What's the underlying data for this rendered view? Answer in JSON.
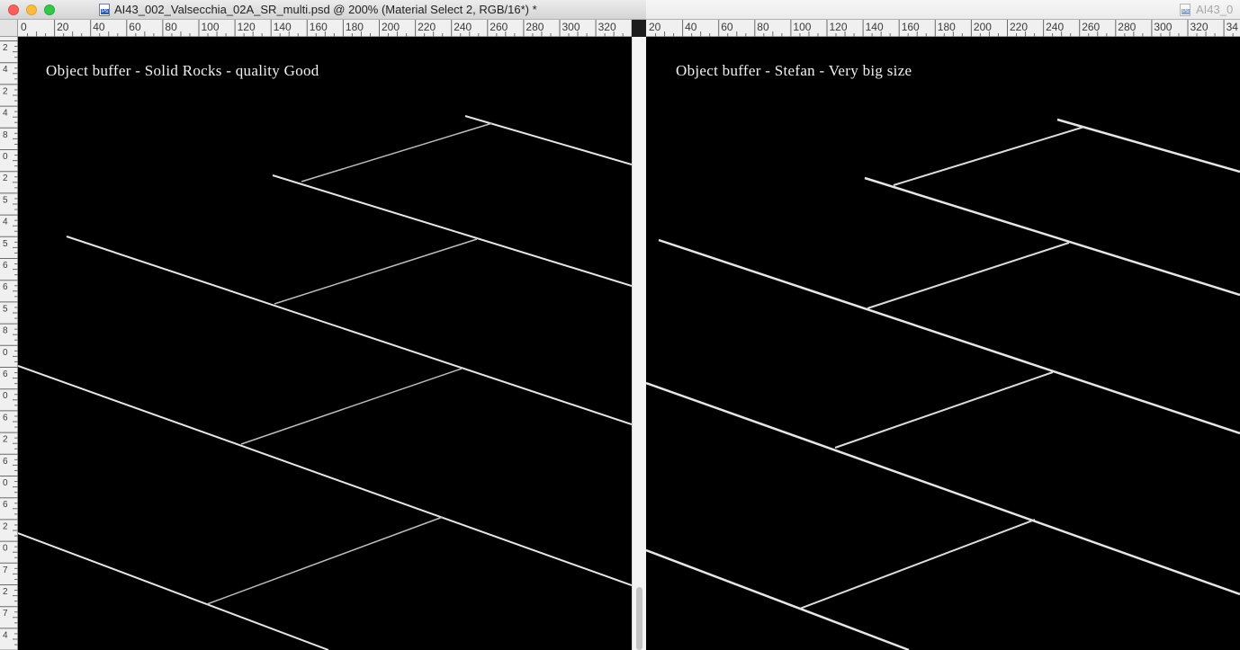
{
  "left_window": {
    "title": "AI43_002_Valsecchia_02A_SR_multi.psd @ 200% (Material Select 2, RGB/16*) *",
    "caption": "Object buffer - Solid Rocks - quality Good",
    "ruler_labels": [
      "0",
      "20",
      "40",
      "60",
      "80",
      "100",
      "120",
      "140",
      "160",
      "180",
      "200",
      "220",
      "240",
      "260",
      "280",
      "300",
      "320"
    ],
    "vruler_labels": [
      "2",
      "4",
      "2",
      "4",
      "8",
      "0",
      "2",
      "5",
      "4",
      "5",
      "6",
      "6",
      "5",
      "8",
      "0",
      "6",
      "0",
      "6",
      "2",
      "6",
      "0",
      "6",
      "2",
      "0",
      "7",
      "2",
      "7",
      "4"
    ]
  },
  "right_window": {
    "title": "AI43_0",
    "caption": "Object buffer - Stefan - Very big size",
    "ruler_labels": [
      "20",
      "40",
      "60",
      "80",
      "100",
      "120",
      "140",
      "160",
      "180",
      "200",
      "220",
      "240",
      "260",
      "280",
      "300",
      "320",
      "34"
    ]
  },
  "colors": {
    "canvas": "#000000",
    "wire": "#e8e8e8",
    "ruler_bg": "#f0f0f0",
    "close": "#fc605c",
    "minimize": "#fdbc40",
    "maximize": "#34c84a"
  },
  "icons": {
    "document": "photoshop-document-icon"
  }
}
